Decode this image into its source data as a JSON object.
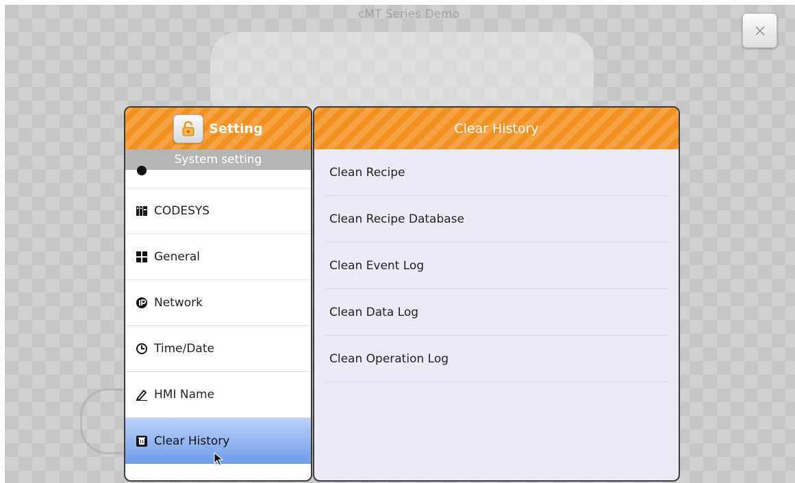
{
  "background": {
    "title": "cMT Series Demo"
  },
  "close_button": {
    "icon": "close-icon"
  },
  "left_panel": {
    "header_title": "Setting",
    "lock_icon": "lock-open-icon",
    "subheader": "System setting",
    "items": [
      {
        "label": "",
        "icon": "partial-icon"
      },
      {
        "label": "CODESYS",
        "icon": "codesys-icon"
      },
      {
        "label": "General",
        "icon": "grid-icon"
      },
      {
        "label": "Network",
        "icon": "ip-icon"
      },
      {
        "label": "Time/Date",
        "icon": "clock-icon"
      },
      {
        "label": "HMI Name",
        "icon": "pen-icon"
      },
      {
        "label": "Clear History",
        "icon": "clear-history-icon",
        "selected": true
      }
    ]
  },
  "right_panel": {
    "header_title": "Clear History",
    "items": [
      {
        "label": "Clean Recipe"
      },
      {
        "label": "Clean Recipe Database"
      },
      {
        "label": "Clean Event Log"
      },
      {
        "label": "Clean Data Log"
      },
      {
        "label": "Clean Operation Log"
      }
    ]
  },
  "colors": {
    "header_orange": "#f39120",
    "selected_blue": "#6f9ce6",
    "subheader_gray": "#b5b5b5"
  }
}
